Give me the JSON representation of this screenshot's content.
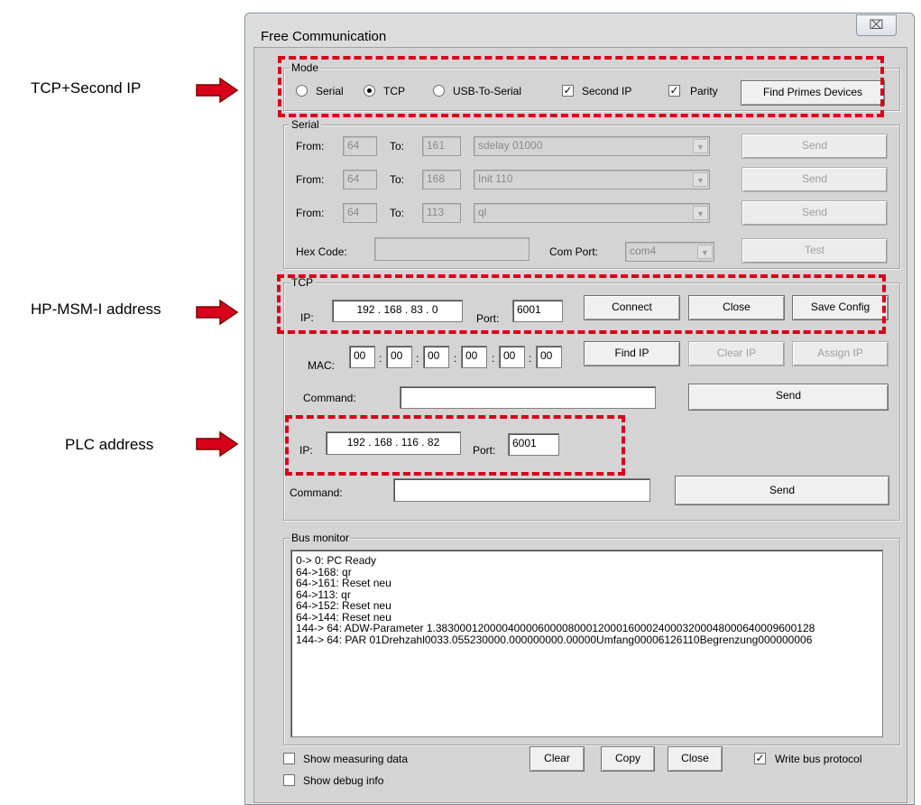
{
  "annotations": [
    {
      "label": "TCP+Second IP"
    },
    {
      "label": "HP-MSM-I address"
    },
    {
      "label": "PLC address"
    }
  ],
  "window": {
    "title": "Free Communication",
    "close_glyph": "⌧"
  },
  "mode": {
    "group_title": "Mode",
    "options": [
      "Serial",
      "TCP",
      "USB-To-Serial"
    ],
    "selected": "TCP",
    "second_ip_label": "Second IP",
    "second_ip_checked": true,
    "parity_label": "Parity",
    "parity_checked": true,
    "find_button": "Find Primes Devices"
  },
  "serial": {
    "group_title": "Serial",
    "from_label": "From:",
    "to_label": "To:",
    "rows": [
      {
        "from": "64",
        "to": "161",
        "command": "sdelay 01000",
        "send": "Send"
      },
      {
        "from": "64",
        "to": "168",
        "command": "Init 110",
        "send": "Send"
      },
      {
        "from": "64",
        "to": "113",
        "command": "ql",
        "send": "Send"
      }
    ],
    "hex_label": "Hex Code:",
    "hex_value": "",
    "com_port_label": "Com Port:",
    "com_port_value": "com4",
    "test_button": "Test"
  },
  "tcp": {
    "group_title": "TCP",
    "ip_label": "IP:",
    "ip": "192 . 168 . 83 . 0",
    "port_label": "Port:",
    "port": "6001",
    "connect": "Connect",
    "close": "Close",
    "save_config": "Save Config",
    "mac_label": "MAC:",
    "mac": [
      "00",
      "00",
      "00",
      "00",
      "00",
      "00"
    ],
    "find_ip": "Find IP",
    "clear_ip": "Clear IP",
    "assign_ip": "Assign IP",
    "command_label": "Command:",
    "command_value": "",
    "send": "Send",
    "ip2_label": "IP:",
    "ip2": "192 . 168 . 116 . 82",
    "port2_label": "Port:",
    "port2": "6001",
    "command2_label": "Command:",
    "command2_value": "",
    "send2": "Send"
  },
  "bus_monitor": {
    "group_title": "Bus monitor",
    "lines": [
      " 0->  0: PC Ready",
      "64->168: qr",
      "64->161: Reset neu",
      "64->113: qr",
      "64->152: Reset neu",
      "64->144: Reset neu",
      "144-> 64: ADW-Parameter 1.383000120000400006000080001200016000240003200048000640009600128",
      "144-> 64: PAR 01Drehzahl0033.055230000.000000000.00000Umfang00006126110Begrenzung000000006"
    ]
  },
  "footer": {
    "show_measuring": "Show measuring data",
    "show_measuring_checked": false,
    "show_debug": "Show debug info",
    "show_debug_checked": false,
    "clear": "Clear",
    "copy": "Copy",
    "close": "Close",
    "write_bus": "Write bus protocol",
    "write_bus_checked": true
  },
  "colors": {
    "annotation_red": "#d8001b"
  }
}
